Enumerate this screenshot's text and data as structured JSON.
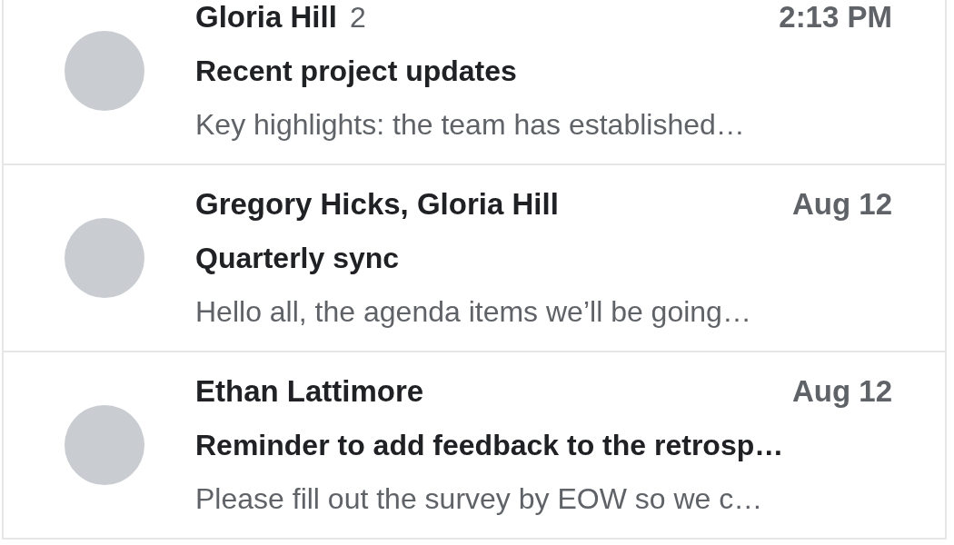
{
  "messages": [
    {
      "sender": "Gloria Hill",
      "count": "2",
      "time": "2:13 PM",
      "subject": "Recent project updates",
      "preview": "Key highlights: the team has established…"
    },
    {
      "sender": "Gregory Hicks, Gloria Hill",
      "time": "Aug 12",
      "subject": "Quarterly sync",
      "preview": "Hello all, the agenda items we’ll be going…"
    },
    {
      "sender": "Ethan Lattimore",
      "time": "Aug 12",
      "subject": "Reminder to add feedback to the retrosp…",
      "preview": "Please fill out the survey by EOW so we c…"
    }
  ]
}
